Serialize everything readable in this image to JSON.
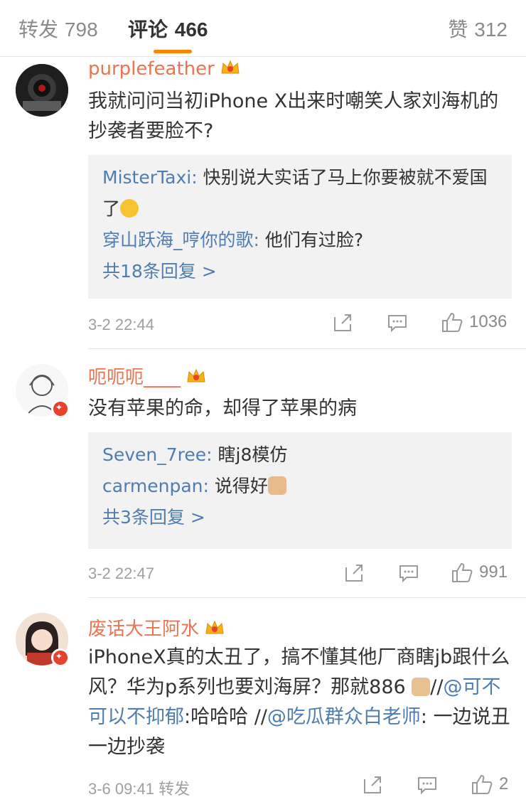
{
  "tabs": {
    "repost": {
      "label": "转发",
      "count": "798"
    },
    "comment": {
      "label": "评论",
      "count": "466"
    },
    "like": {
      "label": "赞",
      "count": "312"
    }
  },
  "comments": [
    {
      "username": "purplefeather",
      "text": "我就问问当初iPhone X出来时嘲笑人家刘海机的抄袭者要脸不?",
      "replies": [
        {
          "name": "MisterTaxi:",
          "text": " 快别说大实话了马上你要被就不爱国了"
        },
        {
          "name": "穿山跃海_哼你的歌:",
          "text": " 他们有过脸?"
        }
      ],
      "more": "共18条回复 >",
      "time": "3-2 22:44",
      "likes": "1036"
    },
    {
      "username": "呃呃呃____",
      "text": "没有苹果的命，却得了苹果的病",
      "replies": [
        {
          "name": "Seven_7ree:",
          "text": " 瞎j8模仿"
        },
        {
          "name": "carmenpan:",
          "text": " 说得好"
        }
      ],
      "more": "共3条回复 >",
      "time": "3-2 22:47",
      "likes": "991"
    },
    {
      "username": "废话大王阿水",
      "text_part1": "iPhoneX真的太丑了，搞不懂其他厂商瞎jb跟什么风？华为p系列也要刘海屏？那就886 ",
      "sep1": "//",
      "mention1": "@可不可以不抑郁",
      "after1": ":哈哈哈 ",
      "sep2": "//",
      "mention2": "@吃瓜群众白老师",
      "after2": ": 一边说丑一边抄袭",
      "time": "3-6 09:41",
      "source": "转发",
      "likes": "2"
    }
  ],
  "colors": {
    "accent": "#ff8200",
    "username": "#eb7350",
    "link": "#507daf"
  },
  "icons": [
    "crown-icon",
    "share-icon",
    "comment-icon",
    "thumbs-up-icon",
    "thinking-emoji",
    "thumbs-up-emoji",
    "fist-emoji",
    "rolling-eyes-emoji"
  ]
}
